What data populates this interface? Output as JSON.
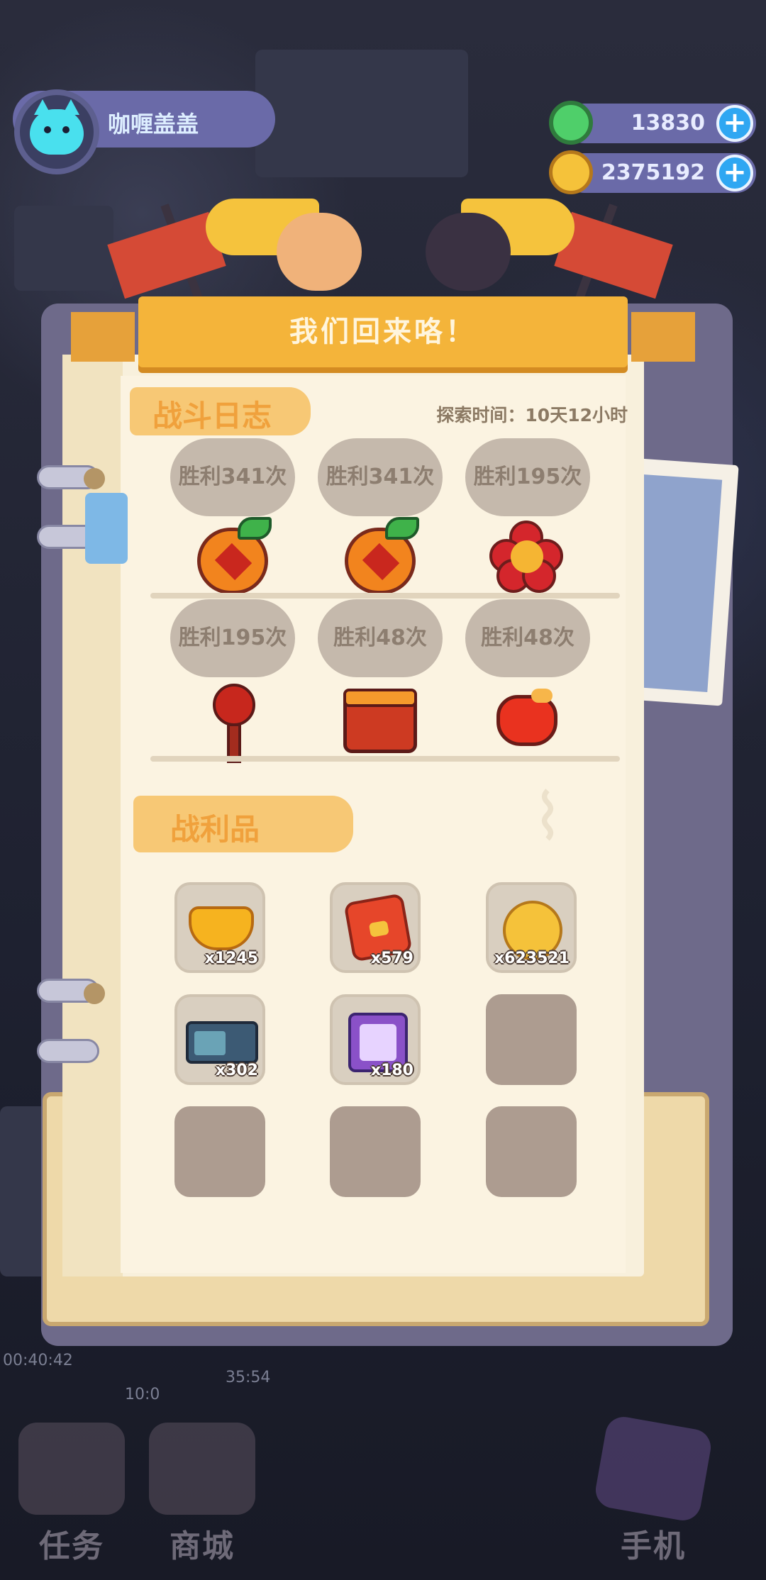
{
  "hud": {
    "username": "咖喱盖盖",
    "currencies": [
      {
        "icon": "donut-gem-icon",
        "value": "13830",
        "color": "#4fcf6a"
      },
      {
        "icon": "planet-coin-icon",
        "value": "2375192",
        "color": "#f5c23a"
      }
    ]
  },
  "dialog": {
    "title": "我们回来咯！",
    "battle_log": {
      "heading": "战斗日志",
      "explore_time": "探索时间：10天12小时",
      "enemies": [
        {
          "icon": "tangerine-enemy-icon",
          "wins": "胜利341次"
        },
        {
          "icon": "tangerine-enemy-icon",
          "wins": "胜利341次"
        },
        {
          "icon": "red-flower-enemy-icon",
          "wins": "胜利195次"
        },
        {
          "icon": "lollipop-enemy-icon",
          "wins": "胜利195次"
        },
        {
          "icon": "drum-enemy-icon",
          "wins": "胜利48次"
        },
        {
          "icon": "lucky-pouch-enemy-icon",
          "wins": "胜利48次"
        }
      ]
    },
    "loot": {
      "heading": "战利品",
      "items": [
        {
          "icon": "gold-ingot-icon",
          "qty": "x1245"
        },
        {
          "icon": "red-envelope-icon",
          "qty": "x579"
        },
        {
          "icon": "planet-coin-icon",
          "qty": "x623521"
        },
        {
          "icon": "arcade-machine-icon",
          "qty": "x302"
        },
        {
          "icon": "refresh-ticket-icon",
          "qty": "x180"
        },
        {
          "icon": "empty-slot",
          "qty": ""
        },
        {
          "icon": "empty-slot",
          "qty": ""
        },
        {
          "icon": "empty-slot",
          "qty": ""
        },
        {
          "icon": "empty-slot",
          "qty": ""
        }
      ]
    }
  },
  "background": {
    "timers": [
      "00:40:42",
      "10:0",
      "35:54"
    ],
    "nav": [
      {
        "label": "任务",
        "icon": "task-book-icon"
      },
      {
        "label": "商城",
        "icon": "shop-icon"
      },
      {
        "label": "手机",
        "icon": "phone-icon"
      }
    ]
  }
}
